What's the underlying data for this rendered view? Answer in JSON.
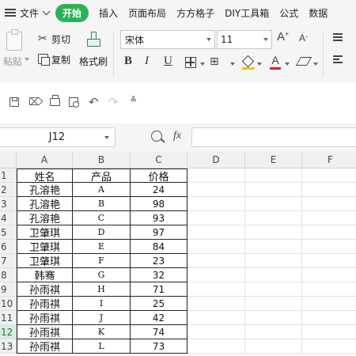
{
  "menu": {
    "file_label": "文件",
    "active_tab": "开始",
    "tabs": [
      "插入",
      "页面布局",
      "方方格子",
      "DIY工具箱",
      "公式",
      "数据"
    ]
  },
  "ribbon": {
    "paste_label": "粘贴",
    "cut_label": "剪切",
    "copy_label": "复制",
    "format_painter_label": "格式刷",
    "font_name": "宋体",
    "font_size": "11",
    "grow_font": "A",
    "shrink_font": "A",
    "bold": "B",
    "italic": "I",
    "underline": "U",
    "font_color_glyph": "A",
    "fill_color": "#f2c200",
    "font_color": "#e02020"
  },
  "quick_access": {
    "icons": [
      "save-icon",
      "format-painter-icon",
      "print-icon",
      "print-preview-icon",
      "undo-icon",
      "redo-icon",
      "customize-icon"
    ]
  },
  "formula_bar": {
    "name_box": "J12",
    "fx": "fx",
    "formula": ""
  },
  "sheet": {
    "columns": [
      "A",
      "B",
      "C",
      "D",
      "E",
      "F"
    ],
    "rows": [
      "1",
      "2",
      "3",
      "4",
      "5",
      "6",
      "7",
      "8",
      "9",
      "10",
      "11",
      "12",
      "13"
    ],
    "active_row": "12",
    "table": [
      [
        "姓名",
        "产品",
        "价格"
      ],
      [
        "孔溶艳",
        "A",
        "24"
      ],
      [
        "孔溶艳",
        "B",
        "98"
      ],
      [
        "孔溶艳",
        "C",
        "93"
      ],
      [
        "卫肇琪",
        "D",
        "97"
      ],
      [
        "卫肇琪",
        "E",
        "84"
      ],
      [
        "卫肇琪",
        "F",
        "23"
      ],
      [
        "韩骞",
        "G",
        "32"
      ],
      [
        "孙雨祺",
        "H",
        "71"
      ],
      [
        "孙雨祺",
        "I",
        "25"
      ],
      [
        "孙雨祺",
        "J",
        "42"
      ],
      [
        "孙雨祺",
        "K",
        "74"
      ],
      [
        "孙雨祺",
        "L",
        "73"
      ]
    ]
  },
  "colors": {
    "accent": "#2bb257",
    "ribbon_bg": "#f5f5f5",
    "header_bg": "#f0f0f0"
  }
}
